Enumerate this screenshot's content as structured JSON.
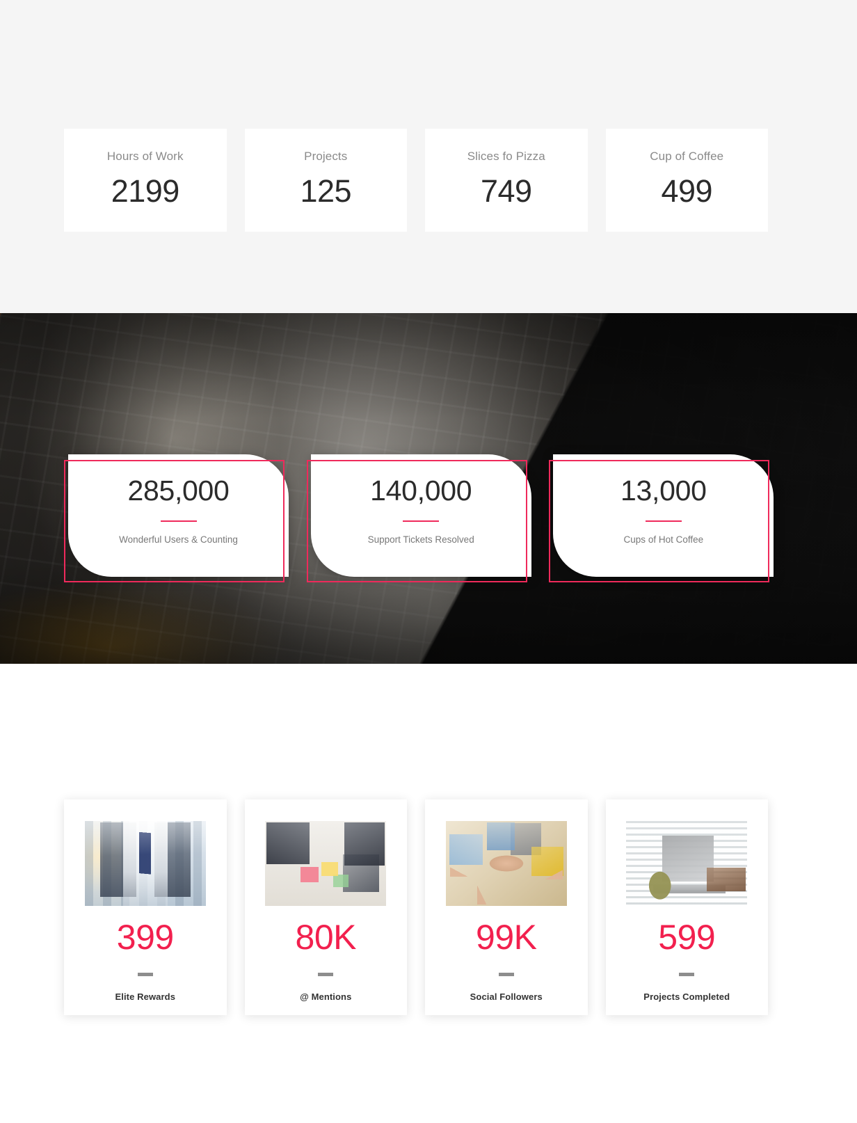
{
  "section_counters": {
    "name": "plain-counters",
    "background_color": "#f5f5f5",
    "cards": [
      {
        "caption": "Hours of Work",
        "value": "2199"
      },
      {
        "caption": "Projects",
        "value": "125"
      },
      {
        "caption": "Slices fo Pizza",
        "value": "749"
      },
      {
        "caption": "Cup of Coffee",
        "value": "499"
      }
    ]
  },
  "section_photo": {
    "name": "photo-banner-counters",
    "accent_color": "#ef2a5b",
    "cards": [
      {
        "value": "285,000",
        "caption": "Wonderful Users & Counting"
      },
      {
        "value": "140,000",
        "caption": "Support Tickets Resolved"
      },
      {
        "value": "13,000",
        "caption": "Cups of Hot Coffee"
      }
    ]
  },
  "section_media": {
    "name": "image-counters",
    "accent_color": "#f2204e",
    "divider_color": "#8d8d8d",
    "cards": [
      {
        "value": "399",
        "caption": "Elite Rewards",
        "image": "businessman-city-skyline-photo"
      },
      {
        "value": "80K",
        "caption": "@ Mentions",
        "image": "team-meeting-sticky-notes-photo"
      },
      {
        "value": "99K",
        "caption": "Social Followers",
        "image": "hands-together-teamwork-photo"
      },
      {
        "value": "599",
        "caption": "Projects Completed",
        "image": "desk-laptop-coffee-mug-photo"
      }
    ]
  }
}
